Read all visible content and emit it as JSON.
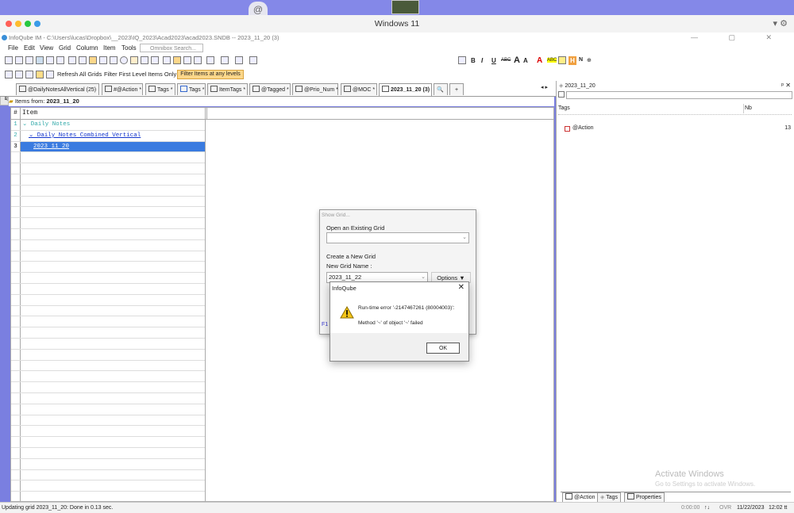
{
  "mac": {
    "title": "Windows 11"
  },
  "app": {
    "title": "InfoQube IM - C:\\Users\\lucas\\Dropbox\\__2023\\IQ_2023\\Acad2023\\acad2023.SNDB -- 2023_11_20 (3)",
    "win_controls": "— ▢ ✕"
  },
  "menu": {
    "items": [
      "File",
      "Edit",
      "View",
      "Grid",
      "Column",
      "Item",
      "Tools"
    ],
    "omnibox_placeholder": "Omnibox Search..."
  },
  "toolbar2": {
    "refresh": "Refresh All Grids",
    "filter_first": "Filter First Level Items Only",
    "filter_any": "Filter Items at any levels"
  },
  "format": {
    "bold": "B",
    "italic": "I",
    "underline": "U",
    "strike": "ABC",
    "grow": "A",
    "shrink": "A",
    "n": "N",
    "highlight": "H"
  },
  "tabs": [
    "@DailyNotesAllVertical (25)",
    "#@Action *",
    "Tags *",
    "Tags *",
    "ItemTags *",
    "@Tagged *",
    "@Prio_Num *",
    "@MOC *",
    "2023_11_20 (3)"
  ],
  "tabs_extra": {
    "binoculars": "🔍",
    "add": "+",
    "nav_arrows": "◂ ▸"
  },
  "navbar": "NavBar",
  "grid": {
    "items_from_label": "Items from:",
    "items_from_value": "2023_11_20",
    "col_num": "#",
    "col_item": "Item",
    "rows": [
      {
        "num": "1",
        "text": "⌄ Daily Notes"
      },
      {
        "num": "2",
        "text": "⌄ Daily Notes Combined Vertical"
      },
      {
        "num": "3",
        "text": "2023 11 20"
      }
    ]
  },
  "right_panel": {
    "title": "2023_11_20",
    "pin": "ᵖ ✕",
    "col_tags": "Tags",
    "col_nb": "Nb",
    "rows": [
      {
        "tag": "@Action",
        "nb": "13"
      }
    ],
    "bottom_tabs": [
      "@Action",
      "Tags",
      "Properties"
    ]
  },
  "showgrid": {
    "title": "Show Grid...",
    "open_existing": "Open an Existing Grid",
    "create_new": "Create a New Grid",
    "new_grid_name_label": "New Grid Name :",
    "new_grid_name_value": "2023_11_22",
    "options": "Options",
    "f1": "F1"
  },
  "error": {
    "title": "InfoQube",
    "line1": "Run-time error '-2147467261 (80004003)':",
    "line2": "Method '~' of object '~' failed",
    "ok": "OK"
  },
  "status": {
    "left": "Updating grid 2023_11_20: Done in 0.13 sec.",
    "time": "0:00:00",
    "ovr": "OVR",
    "date": "11/22/2023",
    "clock": "12:02 tt"
  },
  "watermark": {
    "line1": "Activate Windows",
    "line2": "Go to Settings to activate Windows."
  },
  "colors": {
    "accent": "#3a8fd8",
    "selected_row": "#3a7be0",
    "filter_highlight": "#fcd78a",
    "mac_red": "#ff5f57",
    "mac_yellow": "#febc2e",
    "mac_green": "#28c840"
  }
}
